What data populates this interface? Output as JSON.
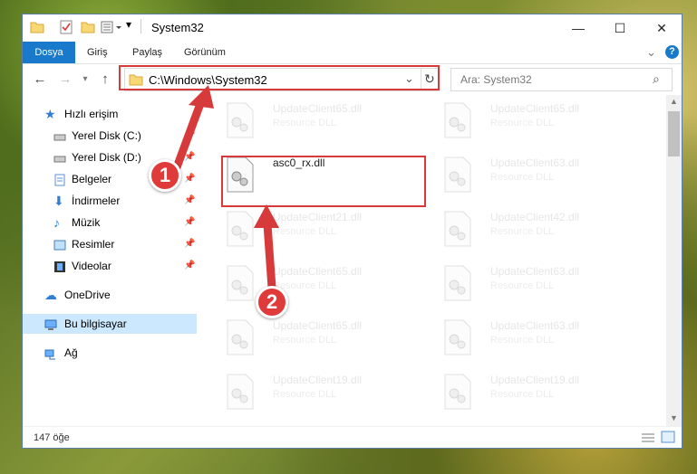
{
  "window": {
    "title": "System32",
    "controls": {
      "minimize": "—",
      "maximize": "☐",
      "close": "✕"
    }
  },
  "ribbon": {
    "tabs": [
      {
        "label": "Dosya",
        "active": true
      },
      {
        "label": "Giriş",
        "active": false
      },
      {
        "label": "Paylaş",
        "active": false
      },
      {
        "label": "Görünüm",
        "active": false
      }
    ],
    "help": "?"
  },
  "navigation": {
    "address": "C:\\Windows\\System32",
    "search_placeholder": "Ara: System32"
  },
  "sidebar": {
    "items": [
      {
        "label": "Hızlı erişim",
        "icon": "star-icon",
        "pinned": false
      },
      {
        "label": "Yerel Disk (C:)",
        "icon": "drive-icon",
        "pinned": true
      },
      {
        "label": "Yerel Disk (D:)",
        "icon": "drive-icon",
        "pinned": true
      },
      {
        "label": "Belgeler",
        "icon": "documents-icon",
        "pinned": true
      },
      {
        "label": "İndirmeler",
        "icon": "download-icon",
        "pinned": true
      },
      {
        "label": "Müzik",
        "icon": "music-icon",
        "pinned": true
      },
      {
        "label": "Resimler",
        "icon": "pictures-icon",
        "pinned": true
      },
      {
        "label": "Videolar",
        "icon": "videos-icon",
        "pinned": true
      },
      {
        "label": "OneDrive",
        "icon": "cloud-icon",
        "pinned": false
      },
      {
        "label": "Bu bilgisayar",
        "icon": "computer-icon",
        "pinned": false,
        "selected": true
      },
      {
        "label": "Ağ",
        "icon": "network-icon",
        "pinned": false
      }
    ]
  },
  "files": [
    {
      "name": "UpdateClient65.dll",
      "type": "Resource DLL"
    },
    {
      "name": "UpdateClient65.dll",
      "type": "Resource DLL"
    },
    {
      "name": "asc0_rx.dll",
      "type": "",
      "highlighted": true
    },
    {
      "name": "UpdateClient63.dll",
      "type": "Resource DLL"
    },
    {
      "name": "UpdateClient21.dll",
      "type": "Resource DLL"
    },
    {
      "name": "UpdateClient42.dll",
      "type": "Resource DLL"
    },
    {
      "name": "UpdateClient65.dll",
      "type": "Resource DLL"
    },
    {
      "name": "UpdateClient63.dll",
      "type": "Resource DLL"
    },
    {
      "name": "UpdateClient65.dll",
      "type": "Resource DLL"
    },
    {
      "name": "UpdateClient63.dll",
      "type": "Resource DLL"
    },
    {
      "name": "UpdateClient19.dll",
      "type": "Resource DLL"
    },
    {
      "name": "UpdateClient19.dll",
      "type": "Resource DLL"
    }
  ],
  "status": {
    "item_count": "147 öğe"
  },
  "annotations": {
    "step1": "1",
    "step2": "2",
    "color": "#e03b3b"
  },
  "colors": {
    "accent": "#1979ca",
    "highlight_border": "#d63a3a",
    "selection": "#cce8ff"
  }
}
